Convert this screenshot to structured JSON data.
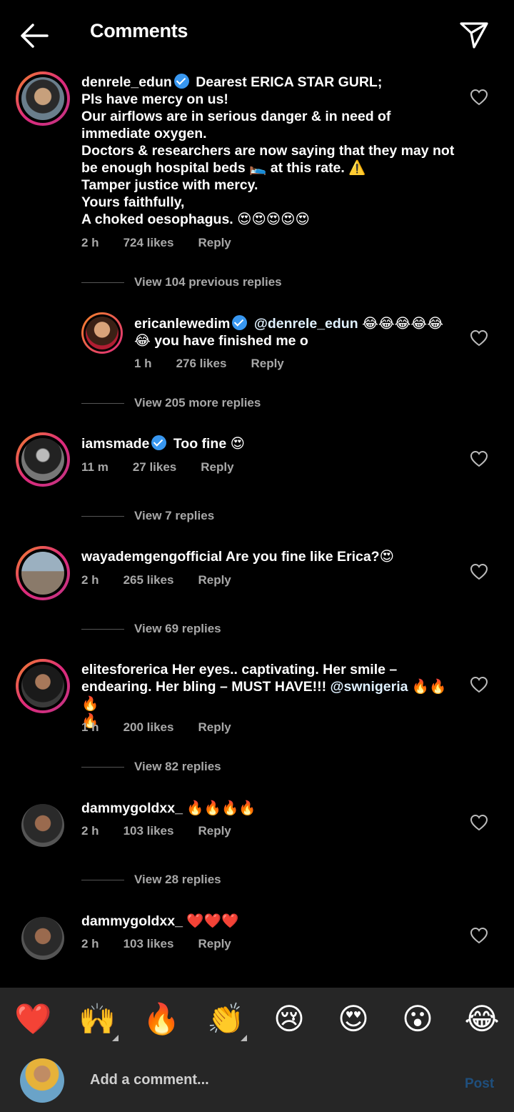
{
  "header": {
    "title": "Comments"
  },
  "comments": [
    {
      "username": "denrele_edun",
      "body": "Dearest ERICA STAR GURL;\nPls have mercy on us!\nOur airflows are in serious danger & in need of immediate oxygen.\nDoctors & researchers are now saying that they may not be enough hospital beds 🛌 at this rate. ⚠️\nTamper justice with mercy.\nYours faithfully,\nA choked oesophagus. 😍😍😍😍😍",
      "time": "2 h",
      "likes": "724 likes",
      "reply": "Reply",
      "view_replies": "View 104 previous replies"
    },
    {
      "username": "ericanlewedim",
      "mention": "@denrele_edun",
      "body": "😂😂😂😂😂\n😂 you have finished me o",
      "time": "1 h",
      "likes": "276 likes",
      "reply": "Reply",
      "view_replies": "View 205 more replies"
    },
    {
      "username": "iamsmade",
      "body": "Too fine 😍",
      "time": "11 m",
      "likes": "27 likes",
      "reply": "Reply",
      "view_replies": "View 7 replies"
    },
    {
      "username": "wayademgengofficial",
      "body": "Are you fine like Erica?😍",
      "time": "2 h",
      "likes": "265 likes",
      "reply": "Reply",
      "view_replies": "View 69 replies"
    },
    {
      "username": "elitesforerica",
      "body_pre": "Her eyes.. captivating. Her smile –\nendearing. Her bling – MUST HAVE!!! ",
      "mention": "@swnigeria",
      "body_post": " 🔥🔥🔥\n🔥",
      "time": "1 h",
      "likes": "200 likes",
      "reply": "Reply",
      "view_replies": "View 82 replies"
    },
    {
      "username": "dammygoldxx_",
      "body": "🔥🔥🔥🔥",
      "time": "2 h",
      "likes": "103 likes",
      "reply": "Reply",
      "view_replies": "View 28 replies"
    },
    {
      "username": "dammygoldxx_",
      "body": "❤️❤️❤️",
      "time": "2 h",
      "likes": "103 likes",
      "reply": "Reply"
    }
  ],
  "emoji_bar": [
    "❤️",
    "🙌",
    "🔥",
    "👏",
    "😢",
    "😍",
    "😮",
    "😂"
  ],
  "composer": {
    "placeholder": "Add a comment...",
    "post_label": "Post"
  },
  "colors": {
    "background": "#000000",
    "verified": "#3897f0",
    "meta": "#a8a8a8",
    "mention": "#e0f1ff",
    "post_disabled": "#1f4f7d"
  }
}
